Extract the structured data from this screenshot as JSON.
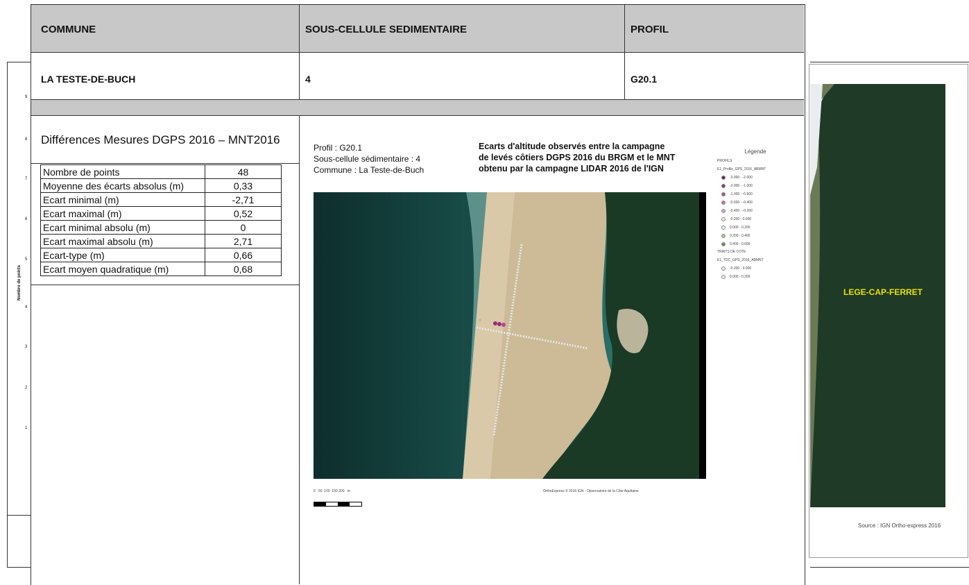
{
  "header": {
    "col1": "COMMUNE",
    "col2": "SOUS-CELLULE SEDIMENTAIRE",
    "col3": "PROFIL",
    "commune": "LA TESTE-DE-BUCH",
    "cellule": "4",
    "profil": "G20.1"
  },
  "stats": {
    "title": "Différences Mesures DGPS 2016 – MNT2016",
    "rows": [
      {
        "label": "Nombre de points",
        "value": "48"
      },
      {
        "label": "Moyenne des écarts absolus (m)",
        "value": "0,33"
      },
      {
        "label": "Ecart minimal (m)",
        "value": "-2,71"
      },
      {
        "label": "Ecart maximal (m)",
        "value": "0,52"
      },
      {
        "label": "Ecart minimal absolu (m)",
        "value": "0"
      },
      {
        "label": "Ecart maximal absolu (m)",
        "value": "2,71"
      },
      {
        "label": "Ecart-type (m)",
        "value": "0,66"
      },
      {
        "label": "Ecart moyen quadratique (m)",
        "value": "0,68"
      }
    ]
  },
  "axis": {
    "label": "Nombre de points",
    "ticks": [
      "9",
      "8",
      "7",
      "6",
      "5",
      "4",
      "3",
      "2",
      "1"
    ]
  },
  "map": {
    "info1": "Profil : G20.1",
    "info2": "Sous-cellule sédimentaire : 4",
    "info3": "Commune : La Teste-de-Buch",
    "title1": "Ecarts d'altitude observés entre la campagne",
    "title2": "de levés côtiers DGPS 2016 du BRGM et le MNT",
    "title3": "obtenu par la campagne LIDAR 2016 de l'IGN",
    "scale": "0   50  100  150 200   m",
    "credit": "OrthoExpress © 2016 IGN - Observatoire de la Côte Aquitaine",
    "legend": {
      "title": "Légende",
      "group1": "PROFILS",
      "layer1": "E1_Profils_GPS_2016_ABMNT",
      "classes": [
        {
          "label": "-3.000 - -2.000",
          "color": "#7a1a5a"
        },
        {
          "label": "-2.000 - -1.000",
          "color": "#9a2a7a"
        },
        {
          "label": "-1.000 - -0.600",
          "color": "#b04a98"
        },
        {
          "label": "-0.600 - -0.400",
          "color": "#c070b0"
        },
        {
          "label": "-0.400 - -0.200",
          "color": "#d8a8d0"
        },
        {
          "label": "-0.200 - 0.000",
          "color": "#eeeeee"
        },
        {
          "label": "0.000 - 0.200",
          "color": "#eeeeee"
        },
        {
          "label": "0.200 - 0.400",
          "color": "#a8d080"
        },
        {
          "label": "0.400 - 0.600",
          "color": "#60a040"
        }
      ],
      "group2": "TRAITS DE COTE",
      "layer2": "E1_TDC_GPS_2016_ABMNT",
      "classes2": [
        {
          "label": "-0.200 - 0.000",
          "color": "#eeeeee"
        },
        {
          "label": "0.000 - 0.200",
          "color": "#eeeeee"
        }
      ]
    }
  },
  "side": {
    "place": "LEGE-CAP-FERRET",
    "source": "Source : IGN Ortho-express 2016"
  }
}
